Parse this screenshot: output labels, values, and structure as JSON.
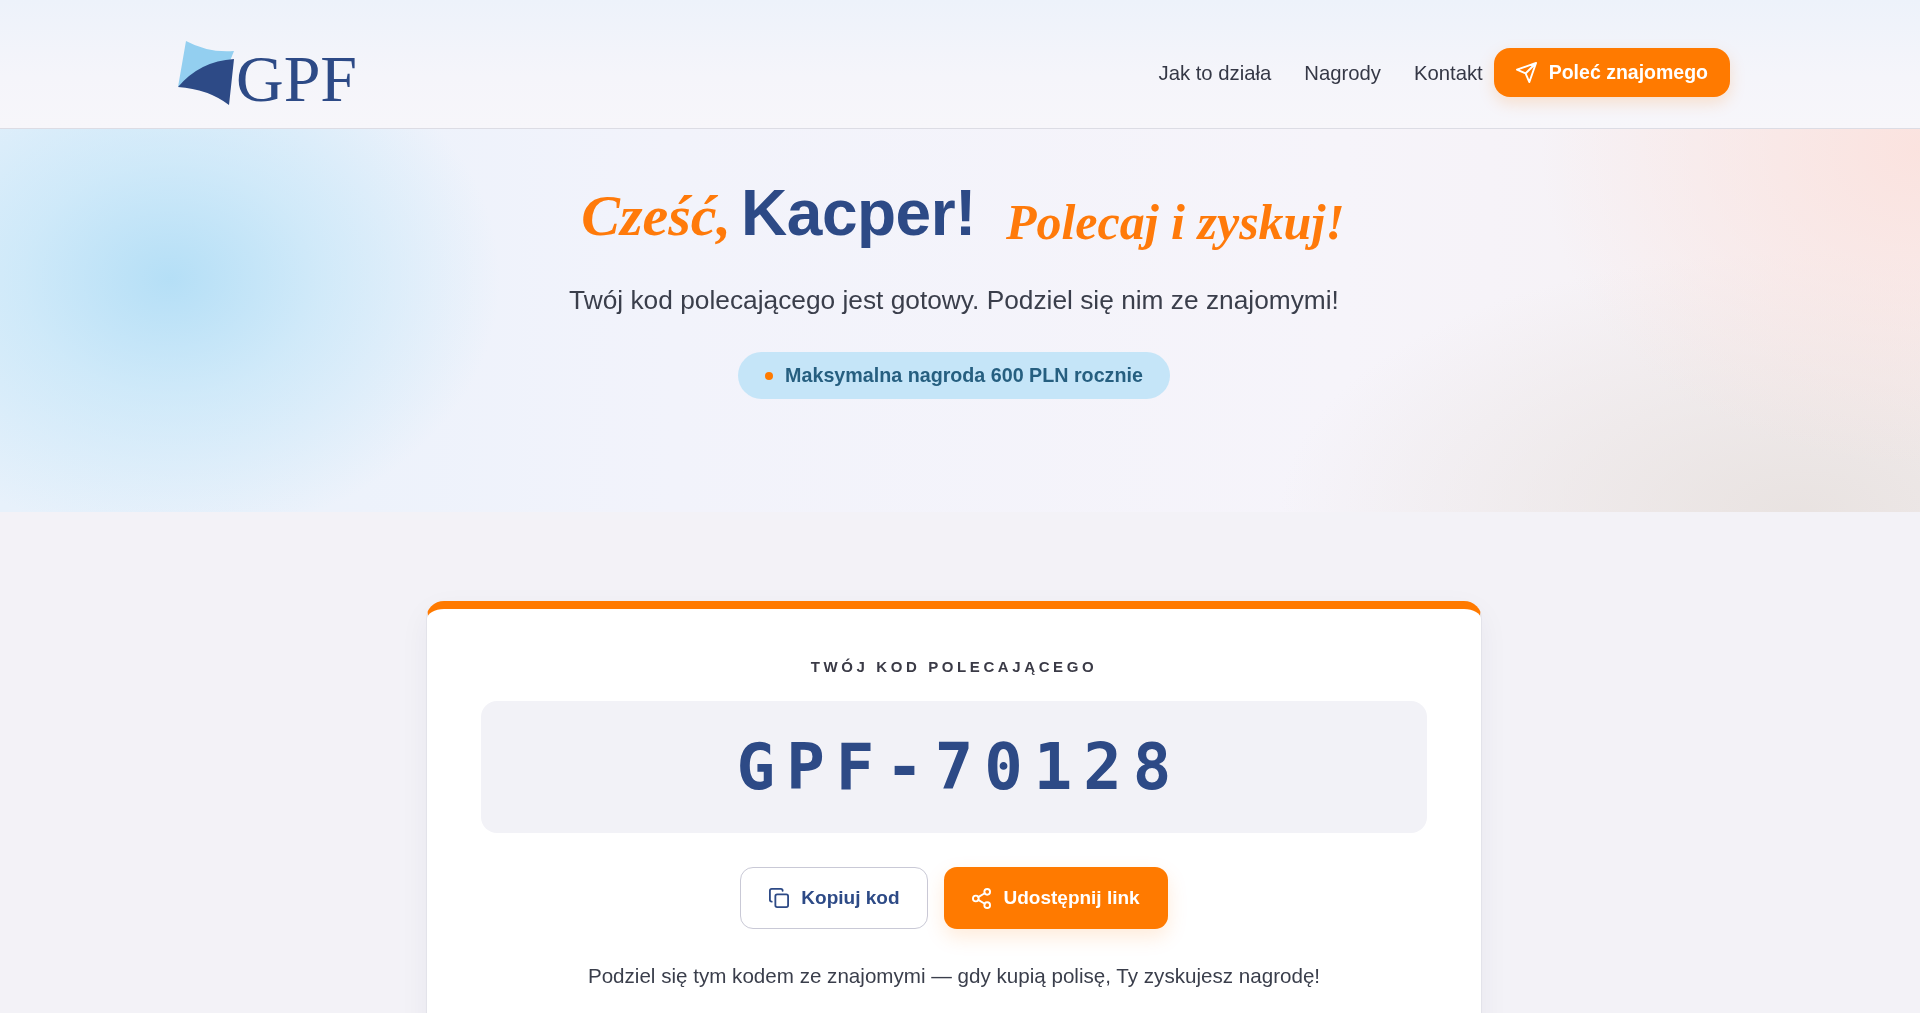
{
  "header": {
    "logo_text": "GPF",
    "nav": [
      "Jak to działa",
      "Nagrody",
      "Kontakt"
    ],
    "cta": "Poleć znajomego"
  },
  "hero": {
    "greeting": "Cześć,",
    "name": "Kacper!",
    "tagline": "Polecaj i zyskuj!",
    "subtitle": "Twój kod polecającego jest gotowy. Podziel się nim ze znajomymi!",
    "badge": "Maksymalna nagroda 600 PLN rocznie"
  },
  "card": {
    "label": "TWÓJ KOD POLECAJĄCEGO",
    "code": "GPF-70128",
    "buttons": [
      {
        "kind": "outline",
        "label": "Kopiuj kod"
      },
      {
        "kind": "filled",
        "label": "Udostępnij link"
      }
    ],
    "note": "Podziel się tym kodem ze znajomymi — gdy kupią polisę, Ty zyskujesz nagrodę!"
  }
}
